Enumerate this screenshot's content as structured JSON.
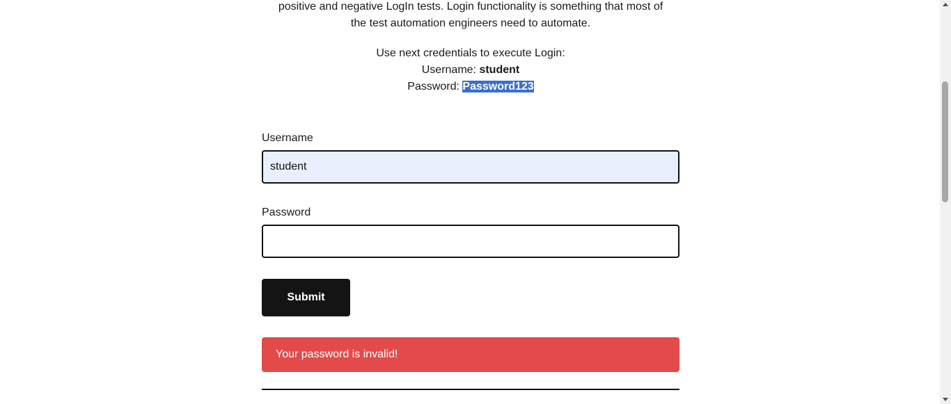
{
  "intro": {
    "line1": "positive and negative LogIn tests. Login functionality is something that most of",
    "line2": "the test automation engineers need to automate."
  },
  "credentials": {
    "heading": "Use next credentials to execute Login:",
    "username_label": "Username: ",
    "username_value": "student",
    "password_label": "Password: ",
    "password_value": "Password123"
  },
  "form": {
    "username_label": "Username",
    "username_value": "student",
    "password_label": "Password",
    "password_value": "",
    "submit_label": "Submit"
  },
  "error": {
    "message": "Your password is invalid!"
  },
  "colors": {
    "error_bg": "#e34a4a",
    "button_bg": "#141414",
    "autofill_bg": "#e8f0fe",
    "selection_bg": "#3b6fce"
  }
}
